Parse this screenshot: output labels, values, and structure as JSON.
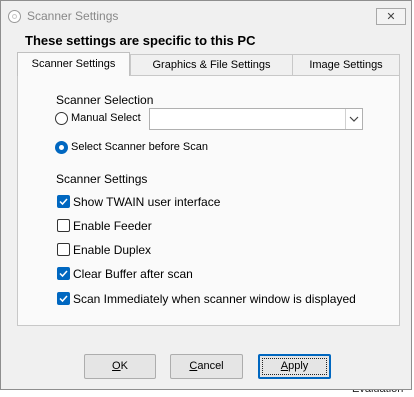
{
  "window": {
    "title": "Scanner Settings",
    "close_glyph": "✕",
    "header": "These settings are specific to this PC"
  },
  "tabs": [
    {
      "label": "Scanner Settings",
      "active": true
    },
    {
      "label": "Graphics & File Settings",
      "active": false
    },
    {
      "label": "Image Settings",
      "active": false
    }
  ],
  "scanner_selection": {
    "heading": "Scanner Selection",
    "manual_select_label": "Manual Select",
    "manual_select_checked": false,
    "select_before_scan_label": "Select Scanner before Scan",
    "select_before_scan_checked": true,
    "scanner_dropdown_value": ""
  },
  "scanner_settings": {
    "heading": "Scanner Settings",
    "options": [
      {
        "label": "Show TWAIN user interface",
        "checked": true
      },
      {
        "label": "Enable Feeder",
        "checked": false
      },
      {
        "label": "Enable Duplex",
        "checked": false
      },
      {
        "label": "Clear Buffer after scan",
        "checked": true
      },
      {
        "label": "Scan Immediately when scanner window is displayed",
        "checked": true
      }
    ]
  },
  "buttons": {
    "ok": {
      "accel": "O",
      "rest": "K"
    },
    "cancel": {
      "accel": "C",
      "rest": "ancel"
    },
    "apply": {
      "accel": "A",
      "rest": "pply"
    }
  },
  "background_text": "Evaluation",
  "colors": {
    "accent": "#0067c0",
    "window_bg": "#f0f0f0",
    "panel_bg": "#fafafa"
  },
  "icons": [
    "app-icon",
    "close-icon",
    "chevron-down-icon",
    "checkmark-icon",
    "radio-dot-icon"
  ]
}
